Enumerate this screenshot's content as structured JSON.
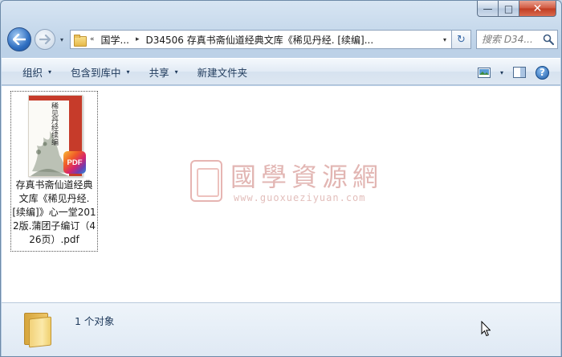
{
  "window": {
    "caption_buttons": {
      "minimize": "—",
      "maximize": "□",
      "close": "✕"
    }
  },
  "nav": {
    "history_dropdown": "▾",
    "address": {
      "overflow": "«",
      "segments": [
        "国学...",
        "D34506 存真书斋仙道经典文库《稀见丹经. [续编]..."
      ],
      "separator": "▸",
      "dropdown": "▾"
    },
    "refresh": "↻",
    "search_placeholder": "搜索 D34..."
  },
  "toolbar": {
    "items": [
      {
        "label": "组织",
        "dropdown": "▾"
      },
      {
        "label": "包含到库中",
        "dropdown": "▾"
      },
      {
        "label": "共享",
        "dropdown": "▾"
      },
      {
        "label": "新建文件夹"
      }
    ],
    "view_dropdown": "▾",
    "help": "?"
  },
  "files": [
    {
      "name": "存真书斋仙道经典文库《稀见丹经. [续编]》心一堂2012版.蒲团子编订（426页）.pdf",
      "badge": "PDF",
      "cover_title": "稀见丹经续编"
    }
  ],
  "watermark": {
    "title": "國學資源網",
    "url": "www.guoxueziyuan.com"
  },
  "status": {
    "count_text": "1 个对象"
  },
  "colors": {
    "accent": "#1e395b",
    "cover_red": "#c63b2a",
    "watermark": "#cc7b76"
  }
}
